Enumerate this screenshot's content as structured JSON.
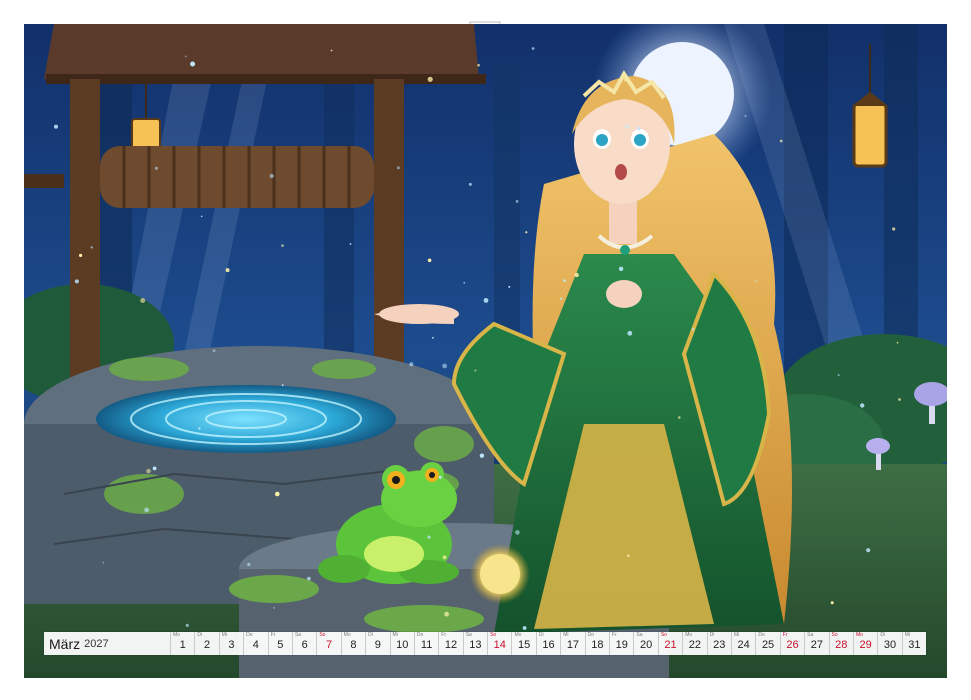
{
  "calendar": {
    "month_name": "März",
    "year": "2027",
    "days": [
      {
        "weekday": "Mo",
        "number": "1",
        "weekend": false
      },
      {
        "weekday": "Di",
        "number": "2",
        "weekend": false
      },
      {
        "weekday": "Mi",
        "number": "3",
        "weekend": false
      },
      {
        "weekday": "Do",
        "number": "4",
        "weekend": false
      },
      {
        "weekday": "Fr",
        "number": "5",
        "weekend": false
      },
      {
        "weekday": "Sa",
        "number": "6",
        "weekend": false
      },
      {
        "weekday": "So",
        "number": "7",
        "weekend": true
      },
      {
        "weekday": "Mo",
        "number": "8",
        "weekend": false
      },
      {
        "weekday": "Di",
        "number": "9",
        "weekend": false
      },
      {
        "weekday": "Mi",
        "number": "10",
        "weekend": false
      },
      {
        "weekday": "Do",
        "number": "11",
        "weekend": false
      },
      {
        "weekday": "Fr",
        "number": "12",
        "weekend": false
      },
      {
        "weekday": "Sa",
        "number": "13",
        "weekend": false
      },
      {
        "weekday": "So",
        "number": "14",
        "weekend": true
      },
      {
        "weekday": "Mo",
        "number": "15",
        "weekend": false
      },
      {
        "weekday": "Di",
        "number": "16",
        "weekend": false
      },
      {
        "weekday": "Mi",
        "number": "17",
        "weekend": false
      },
      {
        "weekday": "Do",
        "number": "18",
        "weekend": false
      },
      {
        "weekday": "Fr",
        "number": "19",
        "weekend": false
      },
      {
        "weekday": "Sa",
        "number": "20",
        "weekend": false
      },
      {
        "weekday": "So",
        "number": "21",
        "weekend": true
      },
      {
        "weekday": "Mo",
        "number": "22",
        "weekend": false
      },
      {
        "weekday": "Di",
        "number": "23",
        "weekend": false
      },
      {
        "weekday": "Mi",
        "number": "24",
        "weekend": false
      },
      {
        "weekday": "Do",
        "number": "25",
        "weekend": false
      },
      {
        "weekday": "Fr",
        "number": "26",
        "weekend": true
      },
      {
        "weekday": "Sa",
        "number": "27",
        "weekend": false
      },
      {
        "weekday": "So",
        "number": "28",
        "weekend": true
      },
      {
        "weekday": "Mo",
        "number": "29",
        "weekend": true
      },
      {
        "weekday": "Di",
        "number": "30",
        "weekend": false
      },
      {
        "weekday": "Mi",
        "number": "31",
        "weekend": false
      }
    ]
  },
  "colors": {
    "weekend_red": "#c8102e",
    "night_blue": "#1d3f7a",
    "dress_green": "#1f6b3c",
    "frog_green": "#5cc43a"
  },
  "illustration": {
    "subject_icons": [
      "well-icon",
      "princess-icon",
      "frog-icon",
      "golden-ball-icon",
      "moon-icon",
      "lantern-icon",
      "mushroom-icon"
    ]
  }
}
